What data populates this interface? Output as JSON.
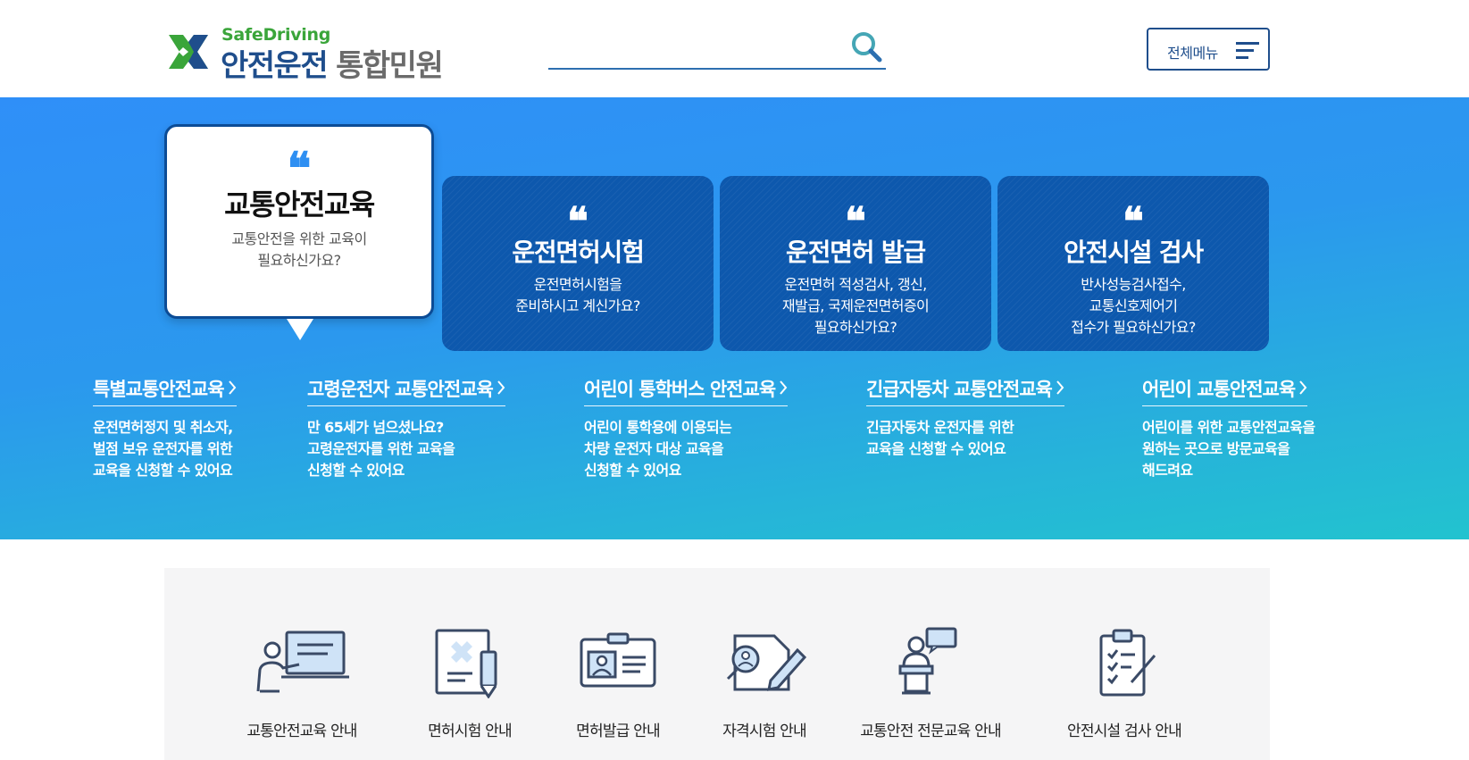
{
  "header": {
    "logo_top": "SafeDriving",
    "logo_main": "안전운전",
    "logo_sub": "통합민원",
    "search_placeholder": "",
    "menu_label": "전체메뉴"
  },
  "hero": {
    "featured": {
      "title": "교통안전교육",
      "desc_line1": "교통안전을 위한 교육이",
      "desc_line2": "필요하신가요?"
    },
    "cards": [
      {
        "title": "운전면허시험",
        "lines": [
          "운전면허시험을",
          "준비하시고 계신가요?"
        ]
      },
      {
        "title": "운전면허 발급",
        "lines": [
          "운전면허 적성검사, 갱신,",
          "재발급, 국제운전면허증이",
          "필요하신가요?"
        ]
      },
      {
        "title": "안전시설 검사",
        "lines": [
          "반사성능검사접수,",
          "교통신호제어기",
          "접수가 필요하신가요?"
        ]
      }
    ],
    "education": [
      {
        "title": "특별교통안전교육",
        "lines": [
          "운전면허정지 및 취소자,",
          "벌점 보유 운전자를 위한",
          "교육을 신청할 수 있어요"
        ]
      },
      {
        "title": "고령운전자 교통안전교육",
        "lines": [
          "만 65세가 넘으셨나요?",
          "고령운전자를 위한 교육을",
          "신청할 수 있어요"
        ]
      },
      {
        "title": "어린이 통학버스 안전교육",
        "lines": [
          "어린이 통학용에 이용되는",
          "차량 운전자 대상 교육을",
          "신청할 수 있어요"
        ]
      },
      {
        "title": "긴급자동차 교통안전교육",
        "lines": [
          "긴급자동차 운전자를 위한",
          "교육을 신청할 수 있어요"
        ]
      },
      {
        "title": "어린이 교통안전교육",
        "lines": [
          "어린이를 위한 교통안전교육을",
          "원하는 곳으로 방문교육을",
          "해드려요"
        ]
      }
    ]
  },
  "services": [
    {
      "label": "교통안전교육 안내",
      "icon": "lecture-icon"
    },
    {
      "label": "면허시험 안내",
      "icon": "exam-document-icon"
    },
    {
      "label": "면허발급 안내",
      "icon": "id-card-icon"
    },
    {
      "label": "자격시험 안내",
      "icon": "certificate-pen-icon"
    },
    {
      "label": "교통안전 전문교육 안내",
      "icon": "speaker-podium-icon"
    },
    {
      "label": "안전시설 검사 안내",
      "icon": "clipboard-checklist-icon"
    }
  ],
  "colors": {
    "brand_navy": "#1f4e8c",
    "brand_green": "#3aa53a",
    "card_blue": "#0d58ad",
    "hero_gradient_start": "#2f8ff8",
    "hero_gradient_end": "#22c3cf",
    "icon_stroke": "#3a4a66",
    "icon_fill": "#cfe3f7"
  }
}
